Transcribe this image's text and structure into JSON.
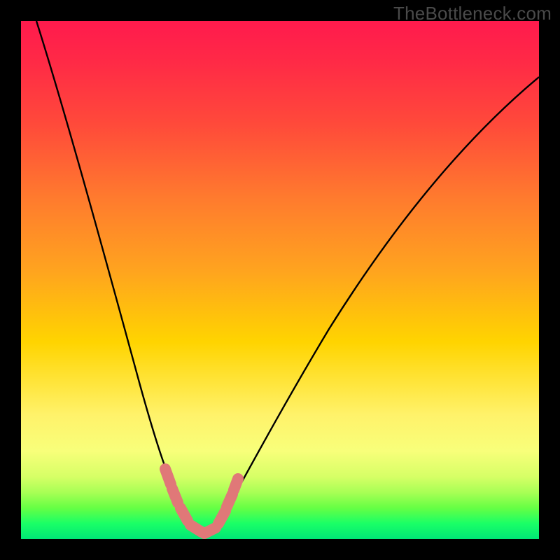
{
  "watermark": "TheBottleneck.com",
  "chart_data": {
    "type": "line",
    "title": "",
    "xlabel": "",
    "ylabel": "",
    "xlim": [
      0,
      100
    ],
    "ylim": [
      0,
      100
    ],
    "grid": false,
    "legend": false,
    "annotations": [],
    "series": [
      {
        "name": "curve",
        "color": "#000000",
        "x": [
          3,
          6,
          10,
          14,
          18,
          22,
          25,
          27,
          28.5,
          30,
          31.5,
          33,
          34.5,
          36,
          37.5,
          39,
          42,
          46,
          50,
          55,
          60,
          66,
          72,
          78,
          84,
          90,
          96,
          100
        ],
        "y": [
          100,
          88,
          74,
          62,
          50,
          38,
          28,
          20,
          14,
          8,
          4,
          2,
          1.5,
          2,
          4,
          8,
          18,
          30,
          40,
          50,
          58,
          66,
          72,
          78,
          83,
          87,
          90,
          92
        ]
      },
      {
        "name": "highlight-dots",
        "type": "scatter",
        "color": "#e57373",
        "x": [
          28.2,
          29.1,
          30.2,
          31.5,
          33.0,
          34.5,
          36.0,
          37.2,
          38.3,
          39.2,
          39.8
        ],
        "y": [
          14,
          9,
          5,
          3,
          2,
          2,
          3,
          5,
          8,
          12,
          16
        ]
      }
    ],
    "colors": {
      "gradient_top": "#ff1a4d",
      "gradient_mid": "#ffd400",
      "gradient_bottom": "#00e676",
      "curve": "#000000",
      "dots": "#e57373",
      "frame": "#000000"
    }
  }
}
